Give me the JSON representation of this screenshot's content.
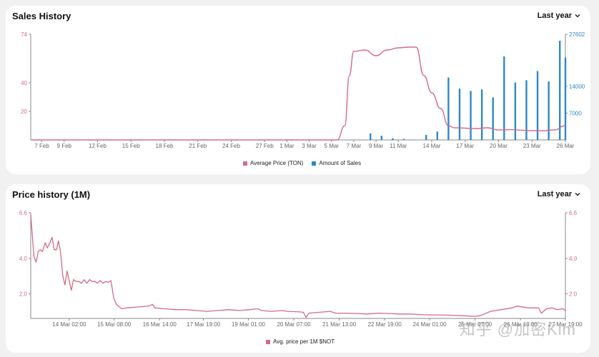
{
  "colors": {
    "price": "#d36b86",
    "sales": "#2f88c9",
    "axis": "#888888"
  },
  "watermark": "知乎 @加密Kim",
  "chart_data": [
    {
      "id": "sales-history",
      "type": "bar+line",
      "title": "Sales History",
      "range_label": "Last year",
      "x_ticks": [
        "7 Feb",
        "9 Feb",
        "12 Feb",
        "15 Feb",
        "18 Feb",
        "21 Feb",
        "24 Feb",
        "27 Feb",
        "1 Mar",
        "3 Mar",
        "5 Mar",
        "7 Mar",
        "9 Mar",
        "11 Mar",
        "14 Mar",
        "17 Mar",
        "20 Mar",
        "23 Mar",
        "26 Mar"
      ],
      "x_tick_days": [
        1,
        3,
        6,
        9,
        12,
        15,
        18,
        21,
        23,
        25,
        27,
        29,
        31,
        33,
        36,
        39,
        42,
        45,
        48
      ],
      "x_range_days": [
        0,
        48
      ],
      "y_left": {
        "label": "Average Price (TON)",
        "ticks": [
          20,
          40,
          74
        ],
        "range": [
          0,
          74
        ]
      },
      "y_right": {
        "label": "Amount of Sales",
        "ticks": [
          7000,
          14000,
          27602
        ],
        "range": [
          0,
          27602
        ]
      },
      "legend": [
        "Average Price (TON)",
        "Amount of Sales"
      ],
      "legend_position": "bottom",
      "series": [
        {
          "name": "Average Price (TON)",
          "kind": "line",
          "points": [
            [
              0,
              0
            ],
            [
              27.5,
              0
            ],
            [
              28.2,
              10
            ],
            [
              28.6,
              45
            ],
            [
              29,
              62
            ],
            [
              30,
              63
            ],
            [
              31,
              59
            ],
            [
              32,
              63
            ],
            [
              33,
              64.5
            ],
            [
              34,
              65
            ],
            [
              34.6,
              65
            ],
            [
              35.3,
              45
            ],
            [
              36,
              33
            ],
            [
              36.8,
              22
            ],
            [
              37.5,
              10
            ],
            [
              38,
              8.5
            ],
            [
              40,
              8
            ],
            [
              41,
              8.5
            ],
            [
              42,
              7
            ],
            [
              43,
              7.2
            ],
            [
              45,
              6.5
            ],
            [
              46,
              6.5
            ],
            [
              47,
              7
            ],
            [
              48,
              10
            ]
          ]
        },
        {
          "name": "Amount of Sales",
          "kind": "bar",
          "points": [
            [
              30.5,
              1700
            ],
            [
              31.5,
              1100
            ],
            [
              32.5,
              450
            ],
            [
              33.5,
              300
            ],
            [
              34.5,
              80
            ],
            [
              35.5,
              1300
            ],
            [
              36.5,
              2200
            ],
            [
              37.5,
              16300
            ],
            [
              38.5,
              13400
            ],
            [
              39.5,
              12800
            ],
            [
              40.5,
              13200
            ],
            [
              41.5,
              11100
            ],
            [
              42.5,
              21800
            ],
            [
              43.5,
              15000
            ],
            [
              44.5,
              15600
            ],
            [
              45.5,
              18000
            ],
            [
              46.5,
              15300
            ],
            [
              47.5,
              25900
            ],
            [
              48,
              21500
            ]
          ]
        }
      ]
    },
    {
      "id": "price-history",
      "type": "line",
      "title": "Price history (1M)",
      "range_label": "Last year",
      "x_ticks": [
        "14 Mar 02:00",
        "15 Mar 08:00",
        "16 Mar 14:00",
        "17 Mar 19:00",
        "19 Mar 01:00",
        "20 Mar 07:00",
        "21 Mar 13:00",
        "22 Mar 19:00",
        "24 Mar 01:00",
        "25 Mar 07:00",
        "26 Mar 13:00",
        "27 Mar 19:00"
      ],
      "x_tick_fraction": [
        0.072,
        0.156,
        0.241,
        0.323,
        0.407,
        0.492,
        0.577,
        0.662,
        0.746,
        0.831,
        0.916,
        1.0
      ],
      "y": {
        "ticks": [
          2.0,
          4.0,
          6.6
        ],
        "range": [
          0.6,
          6.6
        ]
      },
      "legend": [
        "Avg. price per 1M $NOT"
      ],
      "legend_position": "bottom",
      "series": [
        {
          "name": "Avg. price per 1M $NOT",
          "points": [
            [
              0,
              6.5
            ],
            [
              0.006,
              4.1
            ],
            [
              0.01,
              3.8
            ],
            [
              0.014,
              4.4
            ],
            [
              0.018,
              4.5
            ],
            [
              0.022,
              4.4
            ],
            [
              0.027,
              4.9
            ],
            [
              0.031,
              4.6
            ],
            [
              0.036,
              4.9
            ],
            [
              0.04,
              5.2
            ],
            [
              0.044,
              4.5
            ],
            [
              0.048,
              4.5
            ],
            [
              0.052,
              5.0
            ],
            [
              0.056,
              4.3
            ],
            [
              0.06,
              3.0
            ],
            [
              0.064,
              2.5
            ],
            [
              0.068,
              3.3
            ],
            [
              0.072,
              2.7
            ],
            [
              0.076,
              2.2
            ],
            [
              0.08,
              2.8
            ],
            [
              0.085,
              2.7
            ],
            [
              0.09,
              2.7
            ],
            [
              0.095,
              2.6
            ],
            [
              0.1,
              2.8
            ],
            [
              0.105,
              2.6
            ],
            [
              0.11,
              2.8
            ],
            [
              0.115,
              2.7
            ],
            [
              0.12,
              2.7
            ],
            [
              0.125,
              2.6
            ],
            [
              0.13,
              2.75
            ],
            [
              0.135,
              2.6
            ],
            [
              0.14,
              2.7
            ],
            [
              0.145,
              2.65
            ],
            [
              0.15,
              2.75
            ],
            [
              0.155,
              1.8
            ],
            [
              0.16,
              1.4
            ],
            [
              0.17,
              1.15
            ],
            [
              0.18,
              1.2
            ],
            [
              0.2,
              1.25
            ],
            [
              0.22,
              1.3
            ],
            [
              0.228,
              1.4
            ],
            [
              0.232,
              1.2
            ],
            [
              0.25,
              1.15
            ],
            [
              0.27,
              1.1
            ],
            [
              0.29,
              1.1
            ],
            [
              0.31,
              1.05
            ],
            [
              0.33,
              1.0
            ],
            [
              0.35,
              1.05
            ],
            [
              0.37,
              1.1
            ],
            [
              0.39,
              1.05
            ],
            [
              0.41,
              1.1
            ],
            [
              0.425,
              1.15
            ],
            [
              0.432,
              1.05
            ],
            [
              0.45,
              1.0
            ],
            [
              0.47,
              1.05
            ],
            [
              0.48,
              1.0
            ],
            [
              0.5,
              0.98
            ],
            [
              0.51,
              0.95
            ],
            [
              0.515,
              0.65
            ],
            [
              0.52,
              0.9
            ],
            [
              0.54,
              0.95
            ],
            [
              0.56,
              1.0
            ],
            [
              0.57,
              0.9
            ],
            [
              0.59,
              0.9
            ],
            [
              0.61,
              0.88
            ],
            [
              0.63,
              0.85
            ],
            [
              0.65,
              0.9
            ],
            [
              0.67,
              0.88
            ],
            [
              0.69,
              0.85
            ],
            [
              0.71,
              0.85
            ],
            [
              0.73,
              0.82
            ],
            [
              0.75,
              0.8
            ],
            [
              0.77,
              0.8
            ],
            [
              0.79,
              0.78
            ],
            [
              0.81,
              0.75
            ],
            [
              0.83,
              0.72
            ],
            [
              0.84,
              0.75
            ],
            [
              0.86,
              1.0
            ],
            [
              0.88,
              1.1
            ],
            [
              0.9,
              1.2
            ],
            [
              0.91,
              1.3
            ],
            [
              0.93,
              1.2
            ],
            [
              0.95,
              1.2
            ],
            [
              0.955,
              0.9
            ],
            [
              0.965,
              1.15
            ],
            [
              0.975,
              1.2
            ],
            [
              0.985,
              1.1
            ],
            [
              0.995,
              1.15
            ],
            [
              1.0,
              1.05
            ]
          ]
        }
      ]
    }
  ]
}
